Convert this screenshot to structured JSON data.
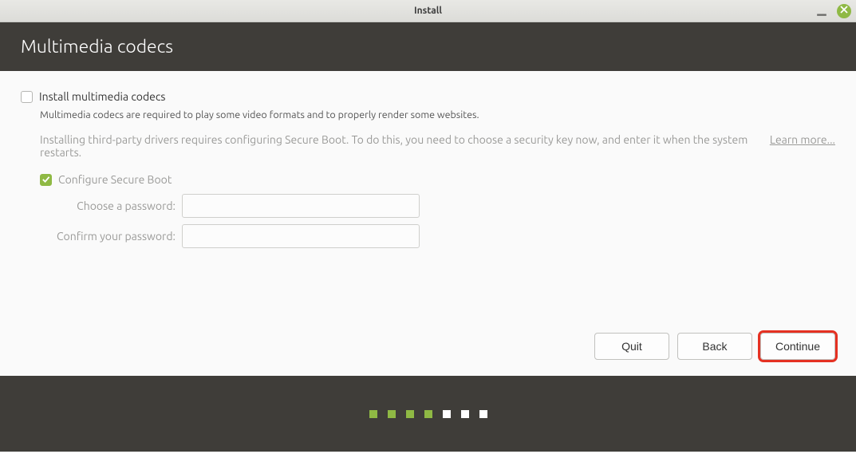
{
  "window": {
    "title": "Install"
  },
  "header": {
    "title": "Multimedia codecs"
  },
  "main": {
    "install_codecs": {
      "checked": false,
      "label": "Install multimedia codecs",
      "description": "Multimedia codecs are required to play some video formats and to properly render some websites."
    },
    "secure_boot": {
      "notice": "Installing third-party drivers requires configuring Secure Boot. To do this, you need to choose a security key now, and enter it when the system restarts.",
      "learn_more": "Learn more...",
      "configure": {
        "checked": true,
        "label": "Configure Secure Boot",
        "disabled": true
      },
      "password_label": "Choose a password:",
      "confirm_label": "Confirm your password:",
      "password_value": "",
      "confirm_value": ""
    }
  },
  "nav": {
    "quit": "Quit",
    "back": "Back",
    "continue": "Continue"
  },
  "progress": {
    "total": 7,
    "current": 4
  }
}
